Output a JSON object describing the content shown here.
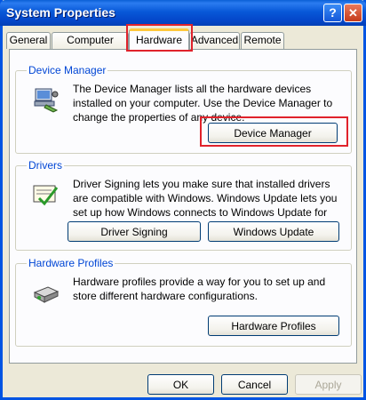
{
  "window": {
    "title": "System Properties"
  },
  "titlebar": {
    "help_glyph": "?",
    "close_glyph": "✕"
  },
  "tabs": [
    {
      "label": "General"
    },
    {
      "label": "Computer Name"
    },
    {
      "label": "Hardware",
      "active": true
    },
    {
      "label": "Advanced"
    },
    {
      "label": "Remote"
    }
  ],
  "device_manager": {
    "title": "Device Manager",
    "description": "The Device Manager lists all the hardware devices installed on your computer. Use the Device Manager to change the properties of any device.",
    "button": "Device Manager",
    "icon": "device-manager-icon"
  },
  "drivers": {
    "title": "Drivers",
    "description": "Driver Signing lets you make sure that installed drivers are compatible with Windows. Windows Update lets you set up how Windows connects to Windows Update for drivers.",
    "signing_button": "Driver Signing",
    "update_button": "Windows Update",
    "icon": "driver-signing-icon"
  },
  "hardware_profiles": {
    "title": "Hardware Profiles",
    "description": "Hardware profiles provide a way for you to set up and store different hardware configurations.",
    "button": "Hardware Profiles",
    "icon": "hardware-profiles-icon"
  },
  "footer": {
    "ok": "OK",
    "cancel": "Cancel",
    "apply": "Apply"
  },
  "colors": {
    "titlebar": "#0858d8",
    "group_title": "#0046d5",
    "highlight": "#e0222b",
    "tab_accent": "#ffc83c"
  }
}
